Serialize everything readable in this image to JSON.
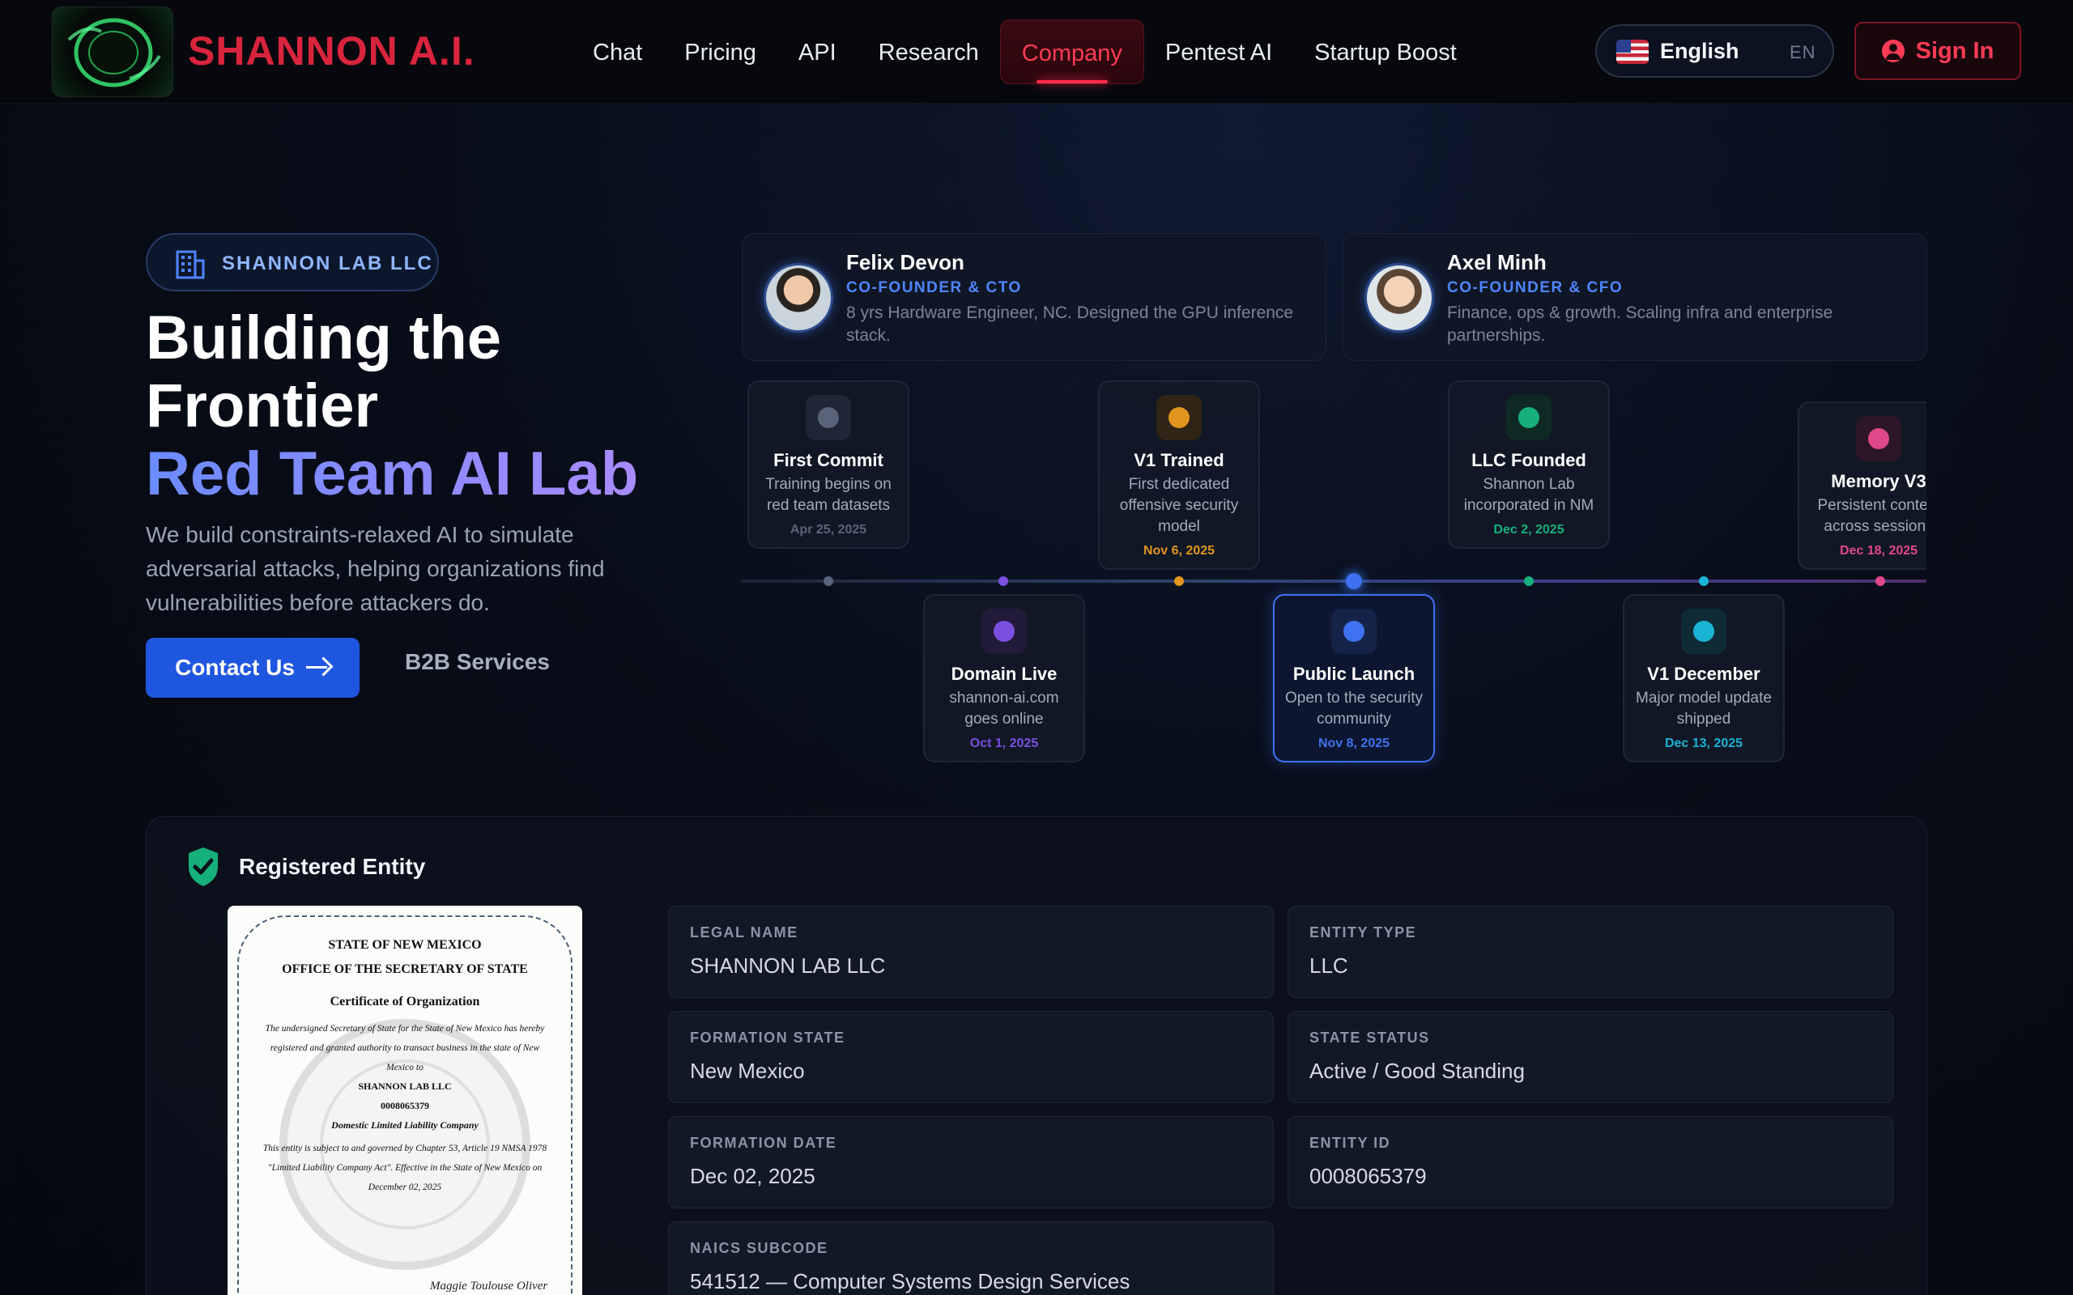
{
  "nav": {
    "brand": "SHANNON A.I.",
    "links": [
      "Chat",
      "Pricing",
      "API",
      "Research",
      "Company",
      "Pentest AI",
      "Startup Boost"
    ],
    "active": "Company",
    "language": {
      "label": "English",
      "code": "EN"
    },
    "sign_in": "Sign In"
  },
  "hero": {
    "badge": "SHANNON LAB LLC",
    "title_line1": "Building the",
    "title_line2": "Frontier",
    "title_line3": "Red Team AI Lab",
    "description": "We build constraints-relaxed AI to simulate adversarial attacks, helping organizations find vulnerabilities before attackers do.",
    "contact_button": "Contact Us",
    "b2b_button": "B2B Services"
  },
  "founders": [
    {
      "name": "Felix Devon",
      "role": "CO-FOUNDER & CTO",
      "bio": "8 yrs Hardware Engineer, NC. Designed the GPU inference stack."
    },
    {
      "name": "Axel Minh",
      "role": "CO-FOUNDER & CFO",
      "bio": "Finance, ops & growth. Scaling infra and enterprise partnerships."
    }
  ],
  "timeline": [
    {
      "title": "First Commit",
      "desc": "Training begins on red team datasets",
      "date": "Apr 25, 2025",
      "color": "#5a6478"
    },
    {
      "title": "Domain Live",
      "desc": "shannon-ai.com goes online",
      "date": "Oct 1, 2025",
      "color": "#7b4fe0"
    },
    {
      "title": "V1 Trained",
      "desc": "First dedicated offensive security model",
      "date": "Nov 6, 2025",
      "color": "#e0951f"
    },
    {
      "title": "Public Launch",
      "desc": "Open to the security community",
      "date": "Nov 8, 2025",
      "color": "#3e72f0"
    },
    {
      "title": "LLC Founded",
      "desc": "Shannon Lab incorporated in NM",
      "date": "Dec 2, 2025",
      "color": "#17b07a"
    },
    {
      "title": "V1 December",
      "desc": "Major model update shipped",
      "date": "Dec 13, 2025",
      "color": "#1bb3d4"
    },
    {
      "title": "Memory V3",
      "desc": "Persistent context across sessions",
      "date": "Dec 18, 2025",
      "color": "#e0488a"
    }
  ],
  "registered": {
    "title": "Registered Entity",
    "certificate": {
      "line1": "STATE OF NEW MEXICO",
      "line2": "OFFICE OF THE SECRETARY OF STATE",
      "line3": "Certificate of Organization",
      "body": "The undersigned Secretary of State for the State of New Mexico has hereby registered and granted authority to transact business in the state of New Mexico to",
      "name": "SHANNON LAB LLC",
      "number": "0008065379",
      "kind": "Domestic Limited Liability Company",
      "body2": "This entity is subject to and governed by Chapter 53, Article 19 NMSA 1978 \"Limited Liability Company Act\". Effective in the State of New Mexico on December 02, 2025",
      "signature": "Maggie Toulouse Oliver"
    },
    "fields": [
      {
        "label": "LEGAL NAME",
        "value": "SHANNON LAB LLC"
      },
      {
        "label": "ENTITY TYPE",
        "value": "LLC"
      },
      {
        "label": "FORMATION STATE",
        "value": "New Mexico"
      },
      {
        "label": "STATE STATUS",
        "value": "Active / Good Standing"
      },
      {
        "label": "FORMATION DATE",
        "value": "Dec 02, 2025"
      },
      {
        "label": "ENTITY ID",
        "value": "0008065379"
      },
      {
        "label": "NAICS SUBCODE",
        "value": "541512 — Computer Systems Design Services"
      }
    ]
  }
}
